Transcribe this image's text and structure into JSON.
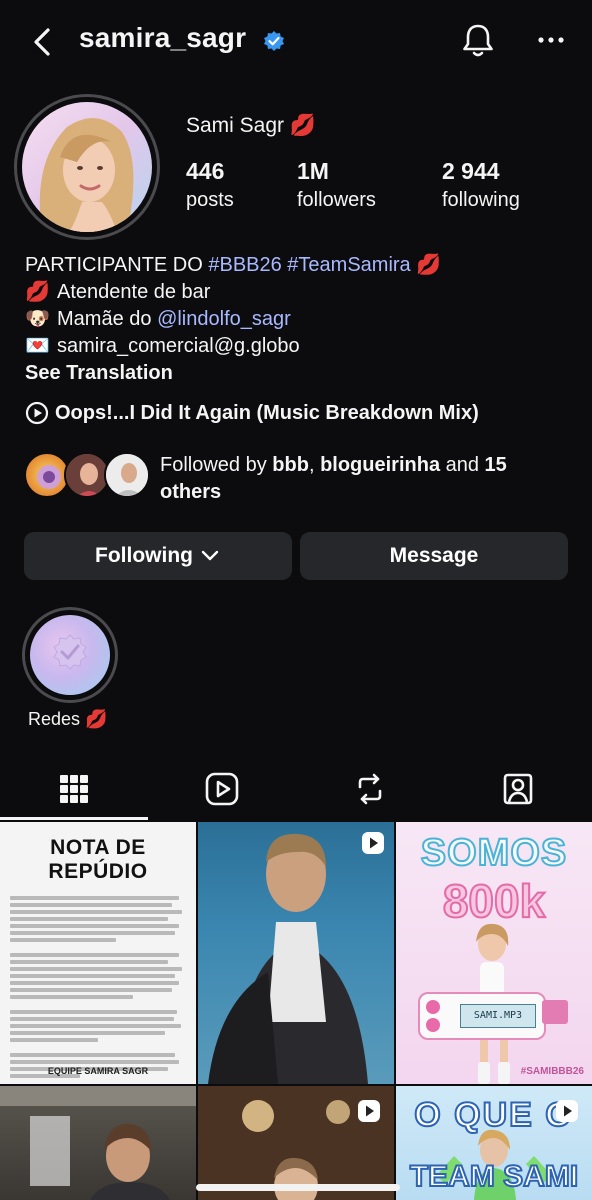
{
  "header": {
    "username": "samira_sagr",
    "colors": {
      "verified": "#3897f0",
      "link": "#a9b8ff",
      "background": "#0c0c0e",
      "button": "#26272b"
    }
  },
  "profile": {
    "display_name": "Sami Sagr 💋",
    "stats": [
      {
        "number": "446",
        "label": "posts"
      },
      {
        "number": "1M",
        "label": "followers"
      },
      {
        "number": "2 944",
        "label": "following"
      }
    ]
  },
  "bio": {
    "line1_prefix": "PARTICIPANTE DO ",
    "line1_tags": "#BBB26 #TeamSamira",
    "line1_emoji": "💋",
    "line2_emoji": "💋",
    "line2_text": "Atendente de bar",
    "line3_emoji": "🐶",
    "line3_prefix": "Mamãe do ",
    "line3_mention": "@lindolfo_sagr",
    "line4_emoji": "💌",
    "line4_text": "samira_comercial@g.globo",
    "see_translation": "See Translation"
  },
  "music": {
    "title": "Oops!...I Did It Again (Music Breakdown Mix)",
    "icon": "play-circle-icon"
  },
  "followed_by": {
    "prefix": "Followed by ",
    "name1": "bbb",
    "sep": ", ",
    "name2": "blogueirinha",
    "and": " and ",
    "count": "15",
    "line2": "others"
  },
  "actions": {
    "following_label": "Following",
    "message_label": "Message"
  },
  "highlights": [
    {
      "label": "Redes 💋"
    }
  ],
  "tabs": [
    "grid-icon",
    "reels-icon",
    "reposts-icon",
    "tagged-icon"
  ],
  "grid": {
    "post1": {
      "title": "NOTA DE REPÚDIO",
      "footer": "EQUIPE SAMIRA SAGR"
    },
    "post3": {
      "headline_top": "SOMOS",
      "headline_bottom": "800k",
      "device_label": "SAMI.MP3",
      "hashtag": "#SAMIBBB26"
    },
    "post6": {
      "text_top": "O QUE O",
      "text_bottom": "TEAM SAMI"
    }
  }
}
